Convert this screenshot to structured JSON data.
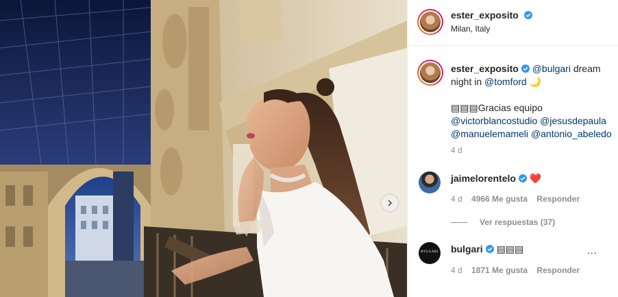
{
  "header": {
    "username": "ester_exposito",
    "location": "Milan, Italy"
  },
  "caption": {
    "username": "ester_exposito",
    "mention_brand": "@bulgari",
    "text_1": " dream",
    "text_2": "night in ",
    "mention_brand2": "@tomford",
    "emoji_moon": "🌙",
    "flags": "▤▤▤",
    "thanks": "Gracias equipo",
    "mention_1": "@victorblancostudio",
    "mention_2": "@jesusdepaula",
    "mention_3": "@manuelemameli",
    "mention_4": "@antonio_abeledo",
    "time": "4 d"
  },
  "comments": [
    {
      "username": "jaimelorentelo",
      "text": "❤️",
      "time": "4 d",
      "likes": "4966 Me gusta",
      "reply": "Responder",
      "view_replies": "Ver respuestas (37)"
    },
    {
      "username": "bulgari",
      "text": "▤▤▤",
      "time": "4 d",
      "likes": "1871 Me gusta",
      "reply": "Responder",
      "more": "..."
    }
  ],
  "colors": {
    "verified": "#3897f0",
    "mention": "#00376b",
    "meta": "#8e8e8e",
    "heart": "#ed4956"
  },
  "icons": {
    "next": "chevron-right-icon",
    "verified": "verified-badge-icon",
    "more": "more-options-icon"
  }
}
